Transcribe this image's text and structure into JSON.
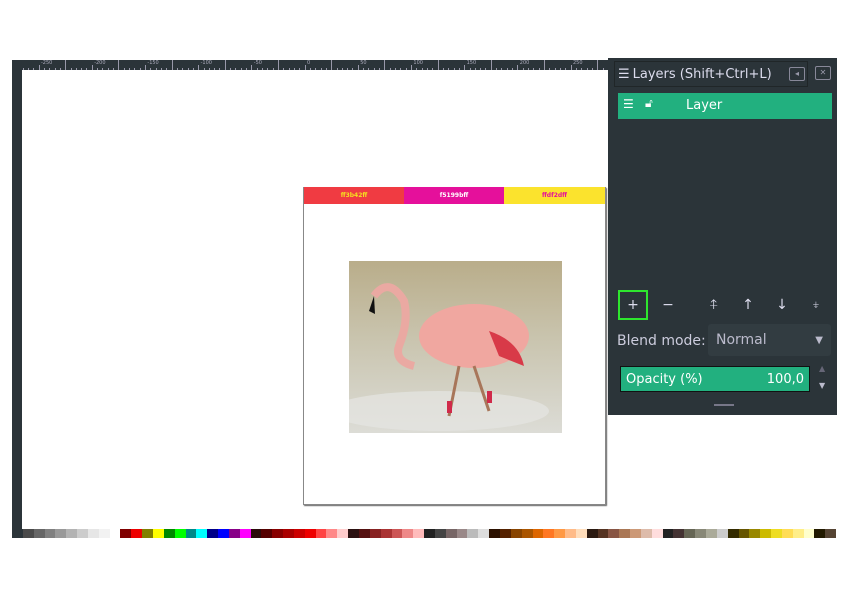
{
  "ruler": {
    "labels": [
      "-250",
      "-200",
      "-150",
      "-100",
      "-50",
      "0",
      "50",
      "100",
      "150",
      "200",
      "250"
    ]
  },
  "document": {
    "swatches": [
      {
        "label": "ff3b42ff",
        "color": "#f03b42",
        "text": "#f5e020"
      },
      {
        "label": "f5199bff",
        "color": "#e5109b",
        "text": "#ffffff"
      },
      {
        "label": "ffdf2dff",
        "color": "#fbe32d",
        "text": "#e5109b"
      }
    ]
  },
  "panel": {
    "title": "Layers (Shift+Ctrl+L)",
    "layer_name": "Layer",
    "blend_label": "Blend mode:",
    "blend_value": "Normal",
    "opacity_label": "Opacity (%)",
    "opacity_value": "100,0",
    "accent": "#22b07f"
  },
  "palette": [
    "#2b3439",
    "#4a4a4a",
    "#666",
    "#808080",
    "#999",
    "#b3b3b3",
    "#ccc",
    "#e6e6e6",
    "#f2f2f2",
    "#fff",
    "#800000",
    "#e00",
    "#808000",
    "#ff0",
    "#080",
    "#0f0",
    "#088",
    "#0ff",
    "#008",
    "#00f",
    "#808",
    "#f0f",
    "#2b0a0a",
    "#500",
    "#800",
    "#a00",
    "#c00",
    "#e00",
    "#f44",
    "#f88",
    "#fcc",
    "#2b1111",
    "#511",
    "#822",
    "#a33",
    "#c55",
    "#e88",
    "#fbb",
    "#222",
    "#444",
    "#766",
    "#988",
    "#bbb",
    "#ddd",
    "#2b1100",
    "#520",
    "#840",
    "#a50",
    "#d60",
    "#f72",
    "#f94",
    "#fb8",
    "#fdb",
    "#2b1a11",
    "#532",
    "#854",
    "#a75",
    "#c97",
    "#dba",
    "#fdd",
    "#222",
    "#433",
    "#665",
    "#887",
    "#aa9",
    "#ccc",
    "#332b00",
    "#650",
    "#980",
    "#cb0",
    "#ed2",
    "#fd5",
    "#fe8",
    "#ffc",
    "#221a00",
    "#543"
  ]
}
